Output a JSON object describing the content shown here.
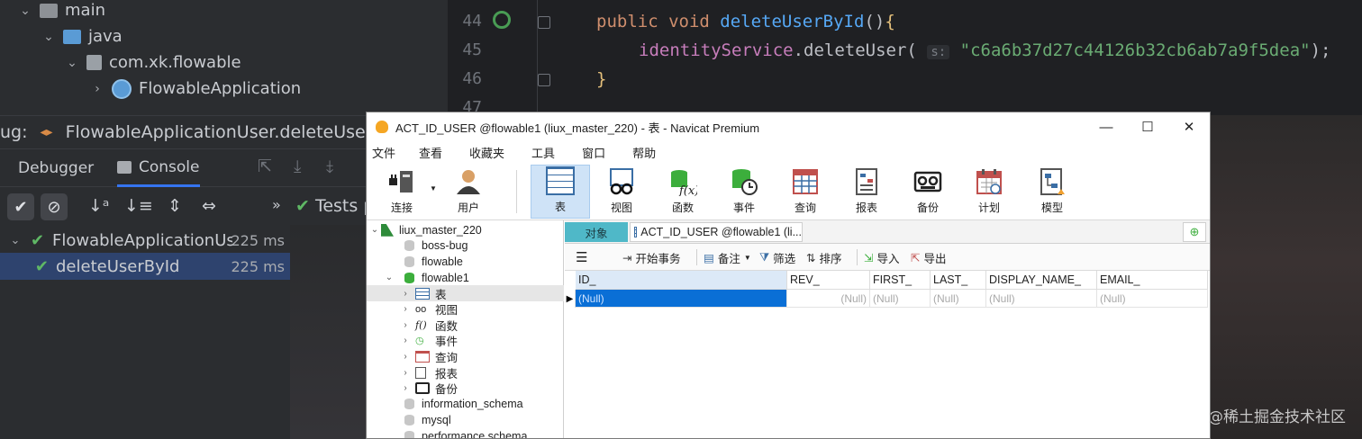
{
  "ide": {
    "project_tree": [
      {
        "label": "main",
        "arrow": "⌄",
        "icon": "folder"
      },
      {
        "label": "java",
        "arrow": "⌄",
        "icon": "folder-blue"
      },
      {
        "label": "com.xk.flowable",
        "arrow": "⌄",
        "icon": "package"
      },
      {
        "label": "FlowableApplication",
        "arrow": "›",
        "icon": "spring-app"
      }
    ],
    "editor": {
      "line_numbers": [
        "44",
        "45",
        "46",
        "47"
      ],
      "line44": {
        "kw": "public void ",
        "fn": "deleteUserById",
        "paren": "()",
        "brace": "{"
      },
      "line45": {
        "obj": "identityService",
        "call": ".deleteUser(",
        "hint": "s:",
        "str": "\"c6a6b37d27c44126b32cb6ab7a9f5dea\"",
        "end": ");"
      },
      "line46": {
        "brace": "}"
      }
    },
    "debug_bar": {
      "prefix": "ug:",
      "config": "FlowableApplicationUser.deleteUserBy"
    },
    "tabs": {
      "debugger": "Debugger",
      "console": "Console"
    },
    "tests_label": "Tests p",
    "tests": [
      {
        "name": "FlowableApplicationUse",
        "duration": "225 ms"
      },
      {
        "name": "deleteUserById",
        "duration": "225 ms"
      }
    ],
    "watermark": "@稀土掘金技术社区"
  },
  "navicat": {
    "title": "ACT_ID_USER @flowable1 (liux_master_220) - 表 - Navicat Premium",
    "window_buttons": [
      "—",
      "☐",
      "✕"
    ],
    "menu": [
      "文件",
      "查看",
      "收藏夹",
      "工具",
      "窗口",
      "帮助"
    ],
    "toolbar": [
      {
        "label": "连接",
        "icon": "connection-icon"
      },
      {
        "label": "用户",
        "icon": "user-icon"
      },
      {
        "label": "表",
        "icon": "table-icon"
      },
      {
        "label": "视图",
        "icon": "view-icon"
      },
      {
        "label": "函数",
        "icon": "function-icon"
      },
      {
        "label": "事件",
        "icon": "event-icon"
      },
      {
        "label": "查询",
        "icon": "query-icon"
      },
      {
        "label": "报表",
        "icon": "report-icon"
      },
      {
        "label": "备份",
        "icon": "backup-icon"
      },
      {
        "label": "计划",
        "icon": "schedule-icon"
      },
      {
        "label": "模型",
        "icon": "model-icon"
      }
    ],
    "sidebar": {
      "connection": "liux_master_220",
      "databases_top": [
        "boss-bug",
        "flowable"
      ],
      "open_db": "flowable1",
      "objects": [
        "表",
        "视图",
        "函数",
        "事件",
        "查询",
        "报表",
        "备份"
      ],
      "databases_bottom": [
        "information_schema",
        "mysql",
        "performance schema"
      ]
    },
    "tabs": {
      "objects": "对象",
      "table_tab": "ACT_ID_USER @flowable1 (li..."
    },
    "actions": {
      "begin_tx": "开始事务",
      "note": "备注",
      "filter": "筛选",
      "sort": "排序",
      "import": "导入",
      "export": "导出"
    },
    "grid": {
      "columns": [
        "ID_",
        "REV_",
        "FIRST_",
        "LAST_",
        "DISPLAY_NAME_",
        "EMAIL_"
      ],
      "row": [
        "(Null)",
        "(Null)",
        "(Null)",
        "(Null)",
        "(Null)",
        "(Null)"
      ]
    }
  },
  "colors": {
    "navicat_selection": "#0a6fd6",
    "ide_bg": "#2b2d30",
    "test_pass": "#5fb865"
  }
}
